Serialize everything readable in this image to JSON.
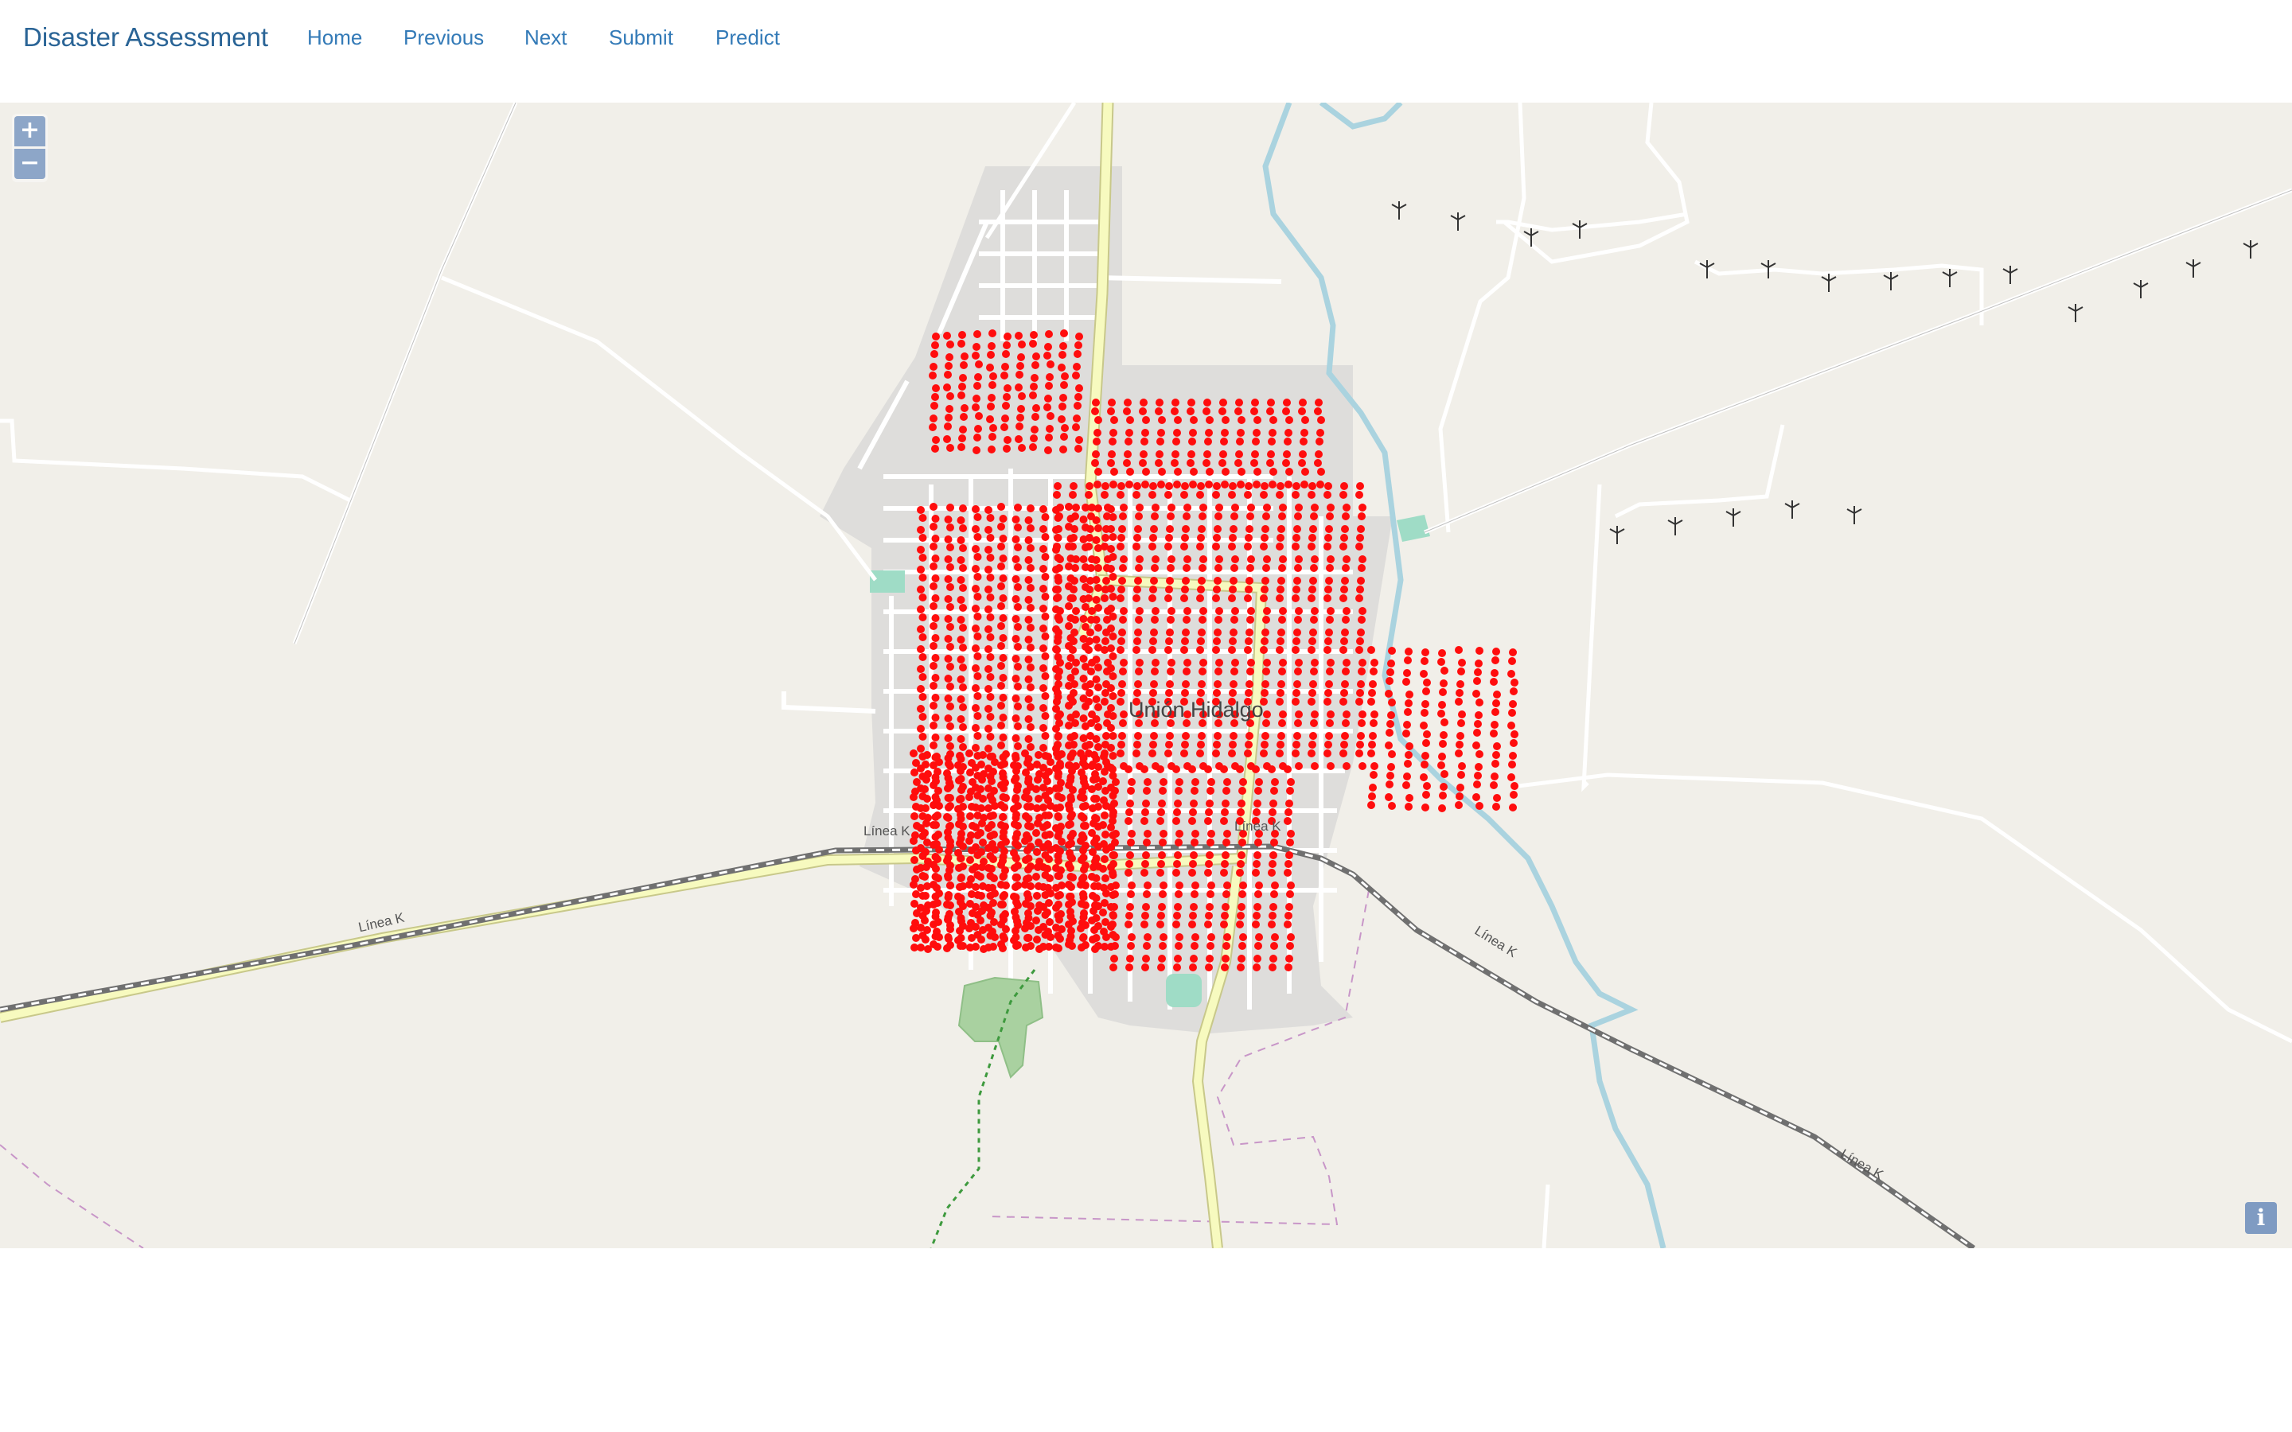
{
  "navbar": {
    "brand": "Disaster Assessment",
    "links": [
      "Home",
      "Previous",
      "Next",
      "Submit",
      "Predict"
    ]
  },
  "map": {
    "zoom_in": "+",
    "zoom_out": "−",
    "attribution": "i",
    "town_label": "Unión Hidalgo",
    "road_labels": [
      "Línea K",
      "Línea K",
      "Línea K",
      "Línea K",
      "Línea K"
    ],
    "colors": {
      "background": "#f1efe9",
      "urban": "#dcdcdc",
      "highway": "#f7fabf",
      "river": "#aad3df",
      "point": "#ff0000"
    },
    "icons": [
      "zoom-in-icon",
      "zoom-out-icon",
      "info-icon",
      "wind-turbine-icon"
    ]
  }
}
